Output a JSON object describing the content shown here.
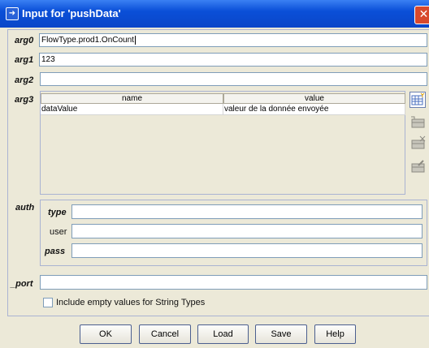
{
  "window": {
    "title": "Input for 'pushData'"
  },
  "args": {
    "arg0": {
      "label": "arg0",
      "value": "FlowType.prod1.OnCount"
    },
    "arg1": {
      "label": "arg1",
      "value": "123"
    },
    "arg2": {
      "label": "arg2",
      "value": ""
    },
    "arg3": {
      "label": "arg3",
      "columns": [
        "name",
        "value"
      ],
      "rows": [
        {
          "name": "dataValue",
          "value": "valeur de la donnée envoyée"
        }
      ]
    }
  },
  "auth": {
    "label": "auth",
    "type": {
      "label": "type",
      "value": ""
    },
    "user": {
      "label": "user",
      "value": ""
    },
    "pass": {
      "label": "pass",
      "value": ""
    }
  },
  "port": {
    "label": "_port",
    "value": ""
  },
  "include_empty": {
    "label": "Include empty values for String Types",
    "checked": false
  },
  "buttons": {
    "ok": "OK",
    "cancel": "Cancel",
    "load": "Load",
    "save": "Save",
    "help": "Help"
  }
}
